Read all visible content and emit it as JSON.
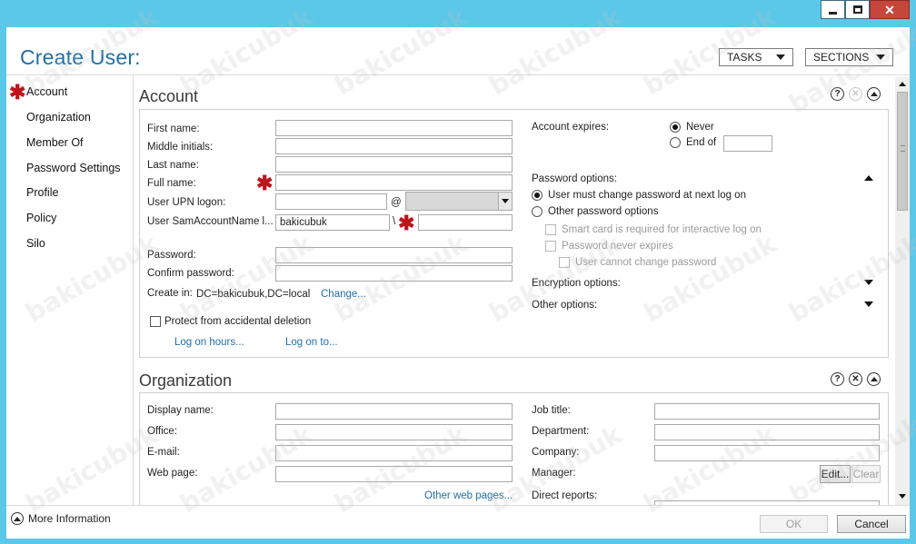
{
  "window": {
    "title": "Create User:"
  },
  "header": {
    "tasks_label": "TASKS",
    "sections_label": "SECTIONS"
  },
  "sidebar": {
    "items": [
      {
        "label": "Account",
        "required": true
      },
      {
        "label": "Organization"
      },
      {
        "label": "Member Of"
      },
      {
        "label": "Password Settings"
      },
      {
        "label": "Profile"
      },
      {
        "label": "Policy"
      },
      {
        "label": "Silo"
      }
    ]
  },
  "account": {
    "title": "Account",
    "first_name_label": "First name:",
    "middle_initials_label": "Middle initials:",
    "last_name_label": "Last name:",
    "full_name_label": "Full name:",
    "upn_label": "User UPN logon:",
    "upn_at": "@",
    "sam_label": "User SamAccountName l...",
    "sam_value": "bakicubuk",
    "sam_sep": "\\",
    "password_label": "Password:",
    "confirm_password_label": "Confirm password:",
    "create_in_label": "Create in:",
    "create_in_value": "DC=bakicubuk,DC=local",
    "change_link": "Change...",
    "protect_label": "Protect from accidental deletion",
    "logon_hours_link": "Log on hours...",
    "logon_to_link": "Log on to...",
    "expires_label": "Account expires:",
    "never_label": "Never",
    "end_of_label": "End of",
    "password_options_label": "Password options:",
    "must_change_label": "User must change password at next log on",
    "other_password_label": "Other password options",
    "smart_card_label": "Smart card is required for interactive log on",
    "never_expires_label": "Password never expires",
    "cannot_change_label": "User cannot change password",
    "encryption_label": "Encryption options:",
    "other_options_label": "Other options:"
  },
  "organization": {
    "title": "Organization",
    "display_name_label": "Display name:",
    "office_label": "Office:",
    "email_label": "E-mail:",
    "web_page_label": "Web page:",
    "other_web_link": "Other web pages...",
    "job_title_label": "Job title:",
    "department_label": "Department:",
    "company_label": "Company:",
    "manager_label": "Manager:",
    "edit_label": "Edit...",
    "clear_label": "Clear",
    "direct_reports_label": "Direct reports:"
  },
  "footer": {
    "more_info_label": "More Information",
    "ok_label": "OK",
    "cancel_label": "Cancel"
  },
  "watermark": "bakicubuk",
  "colors": {
    "accent": "#1f6fa5",
    "required": "#c0141b",
    "titlebar": "#5bc8ea",
    "close": "#c7463b"
  }
}
